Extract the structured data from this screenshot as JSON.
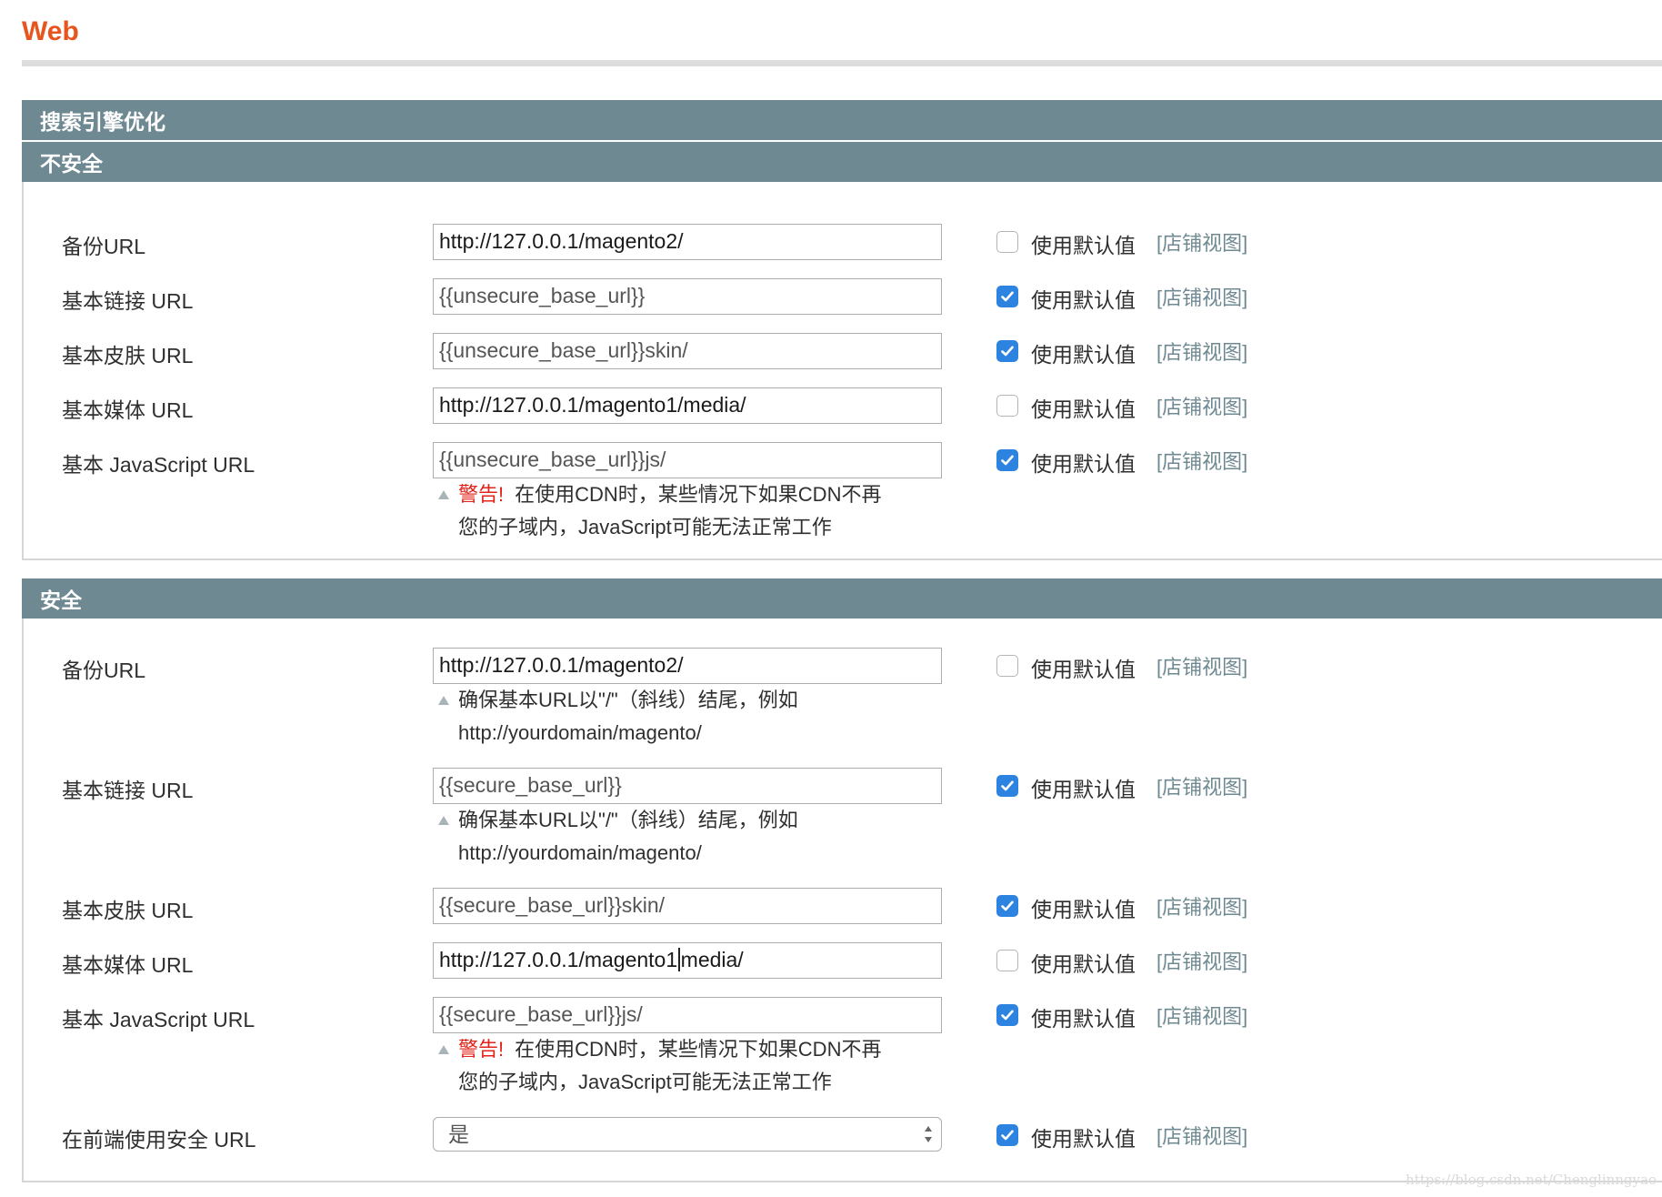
{
  "page": {
    "title": "Web"
  },
  "section_seo": {
    "title": "搜索引擎优化"
  },
  "unsecure": {
    "title": "不安全",
    "rows": [
      {
        "label": "备份URL",
        "value": "http://127.0.0.1/magento2/",
        "use_default": false
      },
      {
        "label": "基本链接 URL",
        "value": "{{unsecure_base_url}}",
        "use_default": true
      },
      {
        "label": "基本皮肤 URL",
        "value": "{{unsecure_base_url}}skin/",
        "use_default": true
      },
      {
        "label": "基本媒体 URL",
        "value": "http://127.0.0.1/magento1/media/",
        "use_default": false
      },
      {
        "label": "基本 JavaScript URL",
        "value": "{{unsecure_base_url}}js/",
        "use_default": true
      }
    ],
    "js_warning": {
      "prefix": "警告!",
      "line1": "在使用CDN时，某些情况下如果CDN不再",
      "line2": "您的子域内，JavaScript可能无法正常工作"
    }
  },
  "secure": {
    "title": "安全",
    "rows": [
      {
        "label": "备份URL",
        "value": "http://127.0.0.1/magento2/",
        "use_default": false
      },
      {
        "label": "基本链接 URL",
        "value": "{{secure_base_url}}",
        "use_default": true
      },
      {
        "label": "基本皮肤 URL",
        "value": "{{secure_base_url}}skin/",
        "use_default": true
      },
      {
        "label": "基本媒体 URL",
        "value_before_caret": "http://127.0.0.1/magento1",
        "value_after_caret": "media/",
        "use_default": false
      },
      {
        "label": "基本 JavaScript URL",
        "value": "{{secure_base_url}}js/",
        "use_default": true
      },
      {
        "label": "在前端使用安全 URL",
        "value": "是",
        "use_default": true
      }
    ],
    "url_hint": {
      "line1": "确保基本URL以\"/\"（斜线）结尾，例如",
      "line2": "http://yourdomain/magento/"
    },
    "js_warning": {
      "prefix": "警告!",
      "line1": "在使用CDN时，某些情况下如果CDN不再",
      "line2": "您的子域内，JavaScript可能无法正常工作"
    }
  },
  "common": {
    "use_default_label": "使用默认值",
    "scope_label": "[店铺视图]"
  },
  "watermark": "https://blog.csdn.net/Chenglinngyao",
  "colors": {
    "accent": "#e8541e",
    "header_bar": "#6f8992",
    "checkbox_on": "#2d84e0",
    "warning": "#e2231a"
  }
}
